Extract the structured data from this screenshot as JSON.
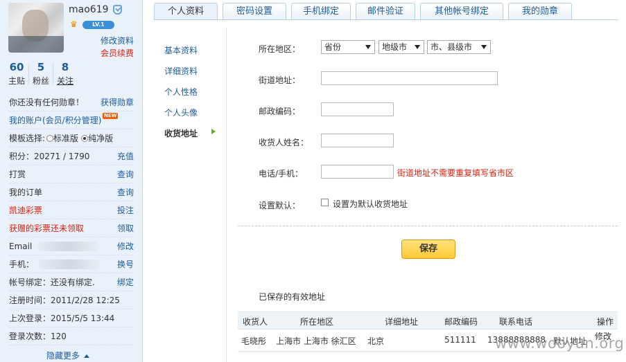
{
  "user": {
    "name": "mao619",
    "level": "LV.1",
    "edit_profile": "修改资料",
    "renew_vip": "会员续费",
    "stats": [
      {
        "value": "60",
        "label": "主贴"
      },
      {
        "value": "5",
        "label": "粉丝"
      },
      {
        "value": "8",
        "label": "关注"
      }
    ]
  },
  "sidebar": {
    "badges_text": "你还没有任何勋章！",
    "badges_link": "获得勋章",
    "account_link": "我的账户(会员/积分管理)",
    "new_badge": "NEW",
    "template_label": "模板选择:",
    "template_standard": "标准版",
    "template_pure": "纯净版",
    "points_label": "积分：20271 / 1790",
    "points_link": "充值",
    "tip_label": "打赏",
    "tip_link": "查询",
    "orders_label": "我的订单",
    "orders_link": "查询",
    "lottery_label": "凯迪彩票",
    "lottery_link": "投注",
    "gift_label": "获赠的彩票还未领取",
    "gift_link": "领取",
    "email_label": "Email",
    "email_link": "修改",
    "mobile_label": "手机：",
    "mobile_link": "换号",
    "bind_label": "帐号绑定：还没有绑定.",
    "bind_link": "绑定",
    "register_label": "注册时间：2011/2/28 12:25",
    "last_login_label": "上次登录：2015/5/5 13:44",
    "login_count_label": "登录次数：120",
    "collapse": "隐藏更多"
  },
  "tabs": [
    "个人资料",
    "密码设置",
    "手机绑定",
    "邮件验证",
    "其他帐号绑定",
    "我的勋章"
  ],
  "subnav": [
    "基本资料",
    "详细资料",
    "个人性格",
    "个人头像",
    "收货地址"
  ],
  "form": {
    "region_label": "所在地区：",
    "province": "省份",
    "city": "地级市",
    "county": "市、县级市",
    "street_label": "街道地址：",
    "postcode_label": "邮政编码：",
    "recipient_label": "收货人姓名：",
    "phone_label": "电话/手机：",
    "phone_hint": "街道地址不需要重复填写省市区",
    "default_label": "设置默认：",
    "default_checkbox": "设置为默认收货地址",
    "save": "保存"
  },
  "saved": {
    "title": "已保存的有效地址",
    "headers": [
      "收货人",
      "所在地区",
      "详细地址",
      "邮政编码",
      "联系电话",
      "操作"
    ],
    "rows": [
      {
        "name": "毛晓彤",
        "region": "上海市 上海市 徐汇区",
        "address": "北京",
        "postcode": "511111",
        "phone": "13888888888",
        "status": "默认地址",
        "action": "修改"
      }
    ]
  },
  "watermark": "www.wooyun.org"
}
